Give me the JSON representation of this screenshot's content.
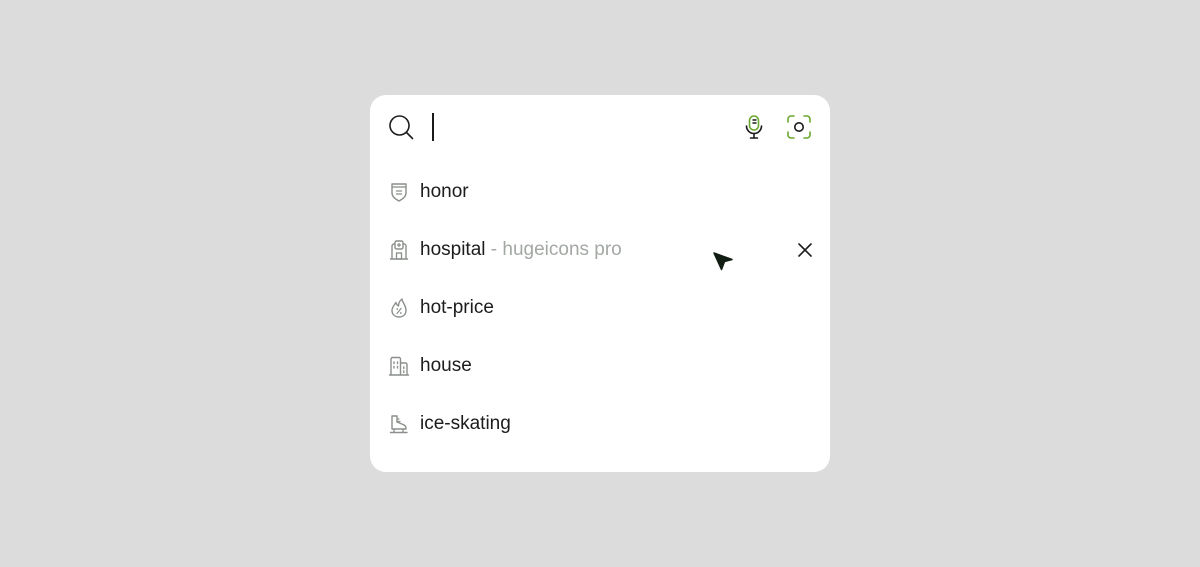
{
  "search": {
    "value": "",
    "placeholder": ""
  },
  "icons": {
    "search": "search-icon",
    "mic": "microphone-icon",
    "camera": "camera-scan-icon",
    "remove": "close-icon"
  },
  "colors": {
    "background": "#dcdcdc",
    "panel": "#ffffff",
    "text": "#1c1c1c",
    "muted": "#a3a8a3",
    "accent": "#6aa82e"
  },
  "suggestions": [
    {
      "label": "honor",
      "meta": "",
      "icon": "badge-icon"
    },
    {
      "label": "hospital",
      "meta": " - hugeicons pro",
      "icon": "hospital-icon"
    },
    {
      "label": "hot-price",
      "meta": "",
      "icon": "discount-flame-icon"
    },
    {
      "label": "house",
      "meta": "",
      "icon": "building-icon"
    },
    {
      "label": "ice-skating",
      "meta": "",
      "icon": "ice-skate-icon"
    }
  ]
}
